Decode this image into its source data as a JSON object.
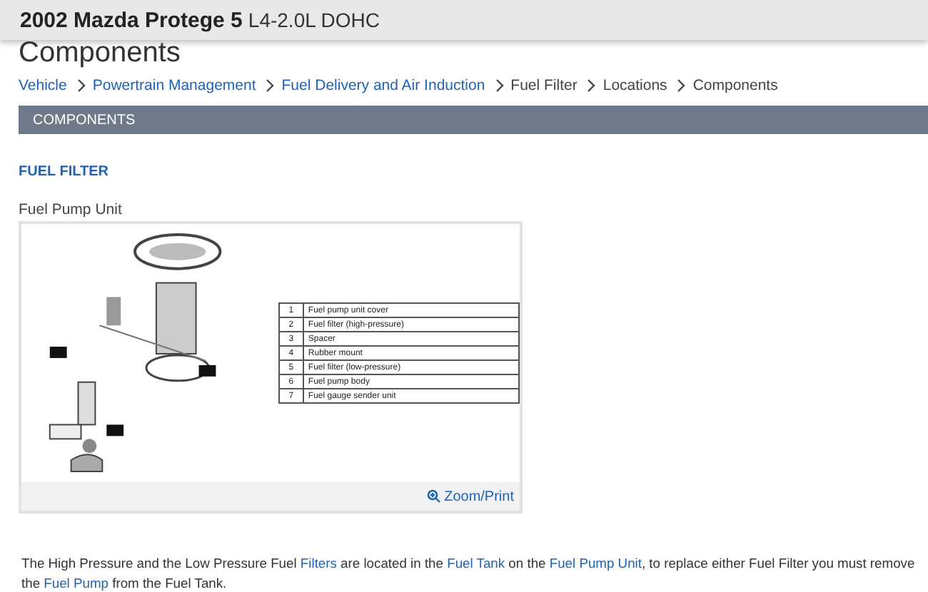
{
  "header": {
    "title": "2002 Mazda Protege 5",
    "engine": "L4-2.0L DOHC"
  },
  "page_title": "Components",
  "breadcrumb": [
    {
      "label": "Vehicle",
      "link": true
    },
    {
      "label": "Powertrain Management",
      "link": true
    },
    {
      "label": "Fuel Delivery and Air Induction",
      "link": true
    },
    {
      "label": "Fuel Filter",
      "link": false
    },
    {
      "label": "Locations",
      "link": false
    },
    {
      "label": "Components",
      "link": false
    }
  ],
  "section_bar": "COMPONENTS",
  "subheading": "FUEL FILTER",
  "figure": {
    "caption": "Fuel Pump Unit",
    "zoom_link": "Zoom/Print",
    "legend": [
      [
        "1",
        "Fuel pump unit cover"
      ],
      [
        "2",
        "Fuel filter (high-pressure)"
      ],
      [
        "3",
        "Spacer"
      ],
      [
        "4",
        "Rubber mount"
      ],
      [
        "5",
        "Fuel filter (low-pressure)"
      ],
      [
        "6",
        "Fuel pump body"
      ],
      [
        "7",
        "Fuel gauge sender unit"
      ]
    ]
  },
  "paragraph": [
    {
      "text": "The High Pressure and the Low Pressure Fuel ",
      "link": false
    },
    {
      "text": "Filters",
      "link": true
    },
    {
      "text": " are located in the ",
      "link": false
    },
    {
      "text": "Fuel Tank",
      "link": true
    },
    {
      "text": " on the ",
      "link": false
    },
    {
      "text": "Fuel Pump Unit",
      "link": true
    },
    {
      "text": ", to replace either Fuel Filter you must remove the ",
      "link": false
    },
    {
      "text": "Fuel Pump",
      "link": true
    },
    {
      "text": " from the Fuel Tank.",
      "link": false
    }
  ]
}
